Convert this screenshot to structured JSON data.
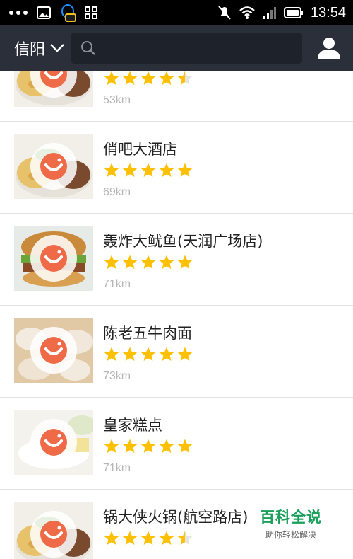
{
  "status_bar": {
    "time": "13:54",
    "icons": [
      "more-dots-icon",
      "gallery-icon",
      "qq-icon",
      "app-grid-icon",
      "mute-icon",
      "wifi-icon",
      "signal-icon",
      "battery-icon"
    ]
  },
  "header": {
    "city": "信阳",
    "search_placeholder": "",
    "colors": {
      "bar": "#2a2f3a",
      "search": "#1d222b"
    }
  },
  "restaurants": [
    {
      "name": "",
      "rating": 4.5,
      "distance": "53km",
      "photo": "pasta"
    },
    {
      "name": "俏吧大酒店",
      "rating": 5,
      "distance": "69km",
      "photo": "pasta"
    },
    {
      "name": "轰炸大鱿鱼(天润广场店)",
      "rating": 5,
      "distance": "71km",
      "photo": "burger"
    },
    {
      "name": "陈老五牛肉面",
      "rating": 5,
      "distance": "73km",
      "photo": "dumpling"
    },
    {
      "name": "皇家糕点",
      "rating": 5,
      "distance": "71km",
      "photo": "cake"
    },
    {
      "name": "锅大侠火锅(航空路店)",
      "rating": 4.5,
      "distance": "",
      "photo": "pasta"
    }
  ],
  "star_color": "#ffc000",
  "watermark": {
    "title": "百科全说",
    "subtitle": "助你轻松解决"
  }
}
